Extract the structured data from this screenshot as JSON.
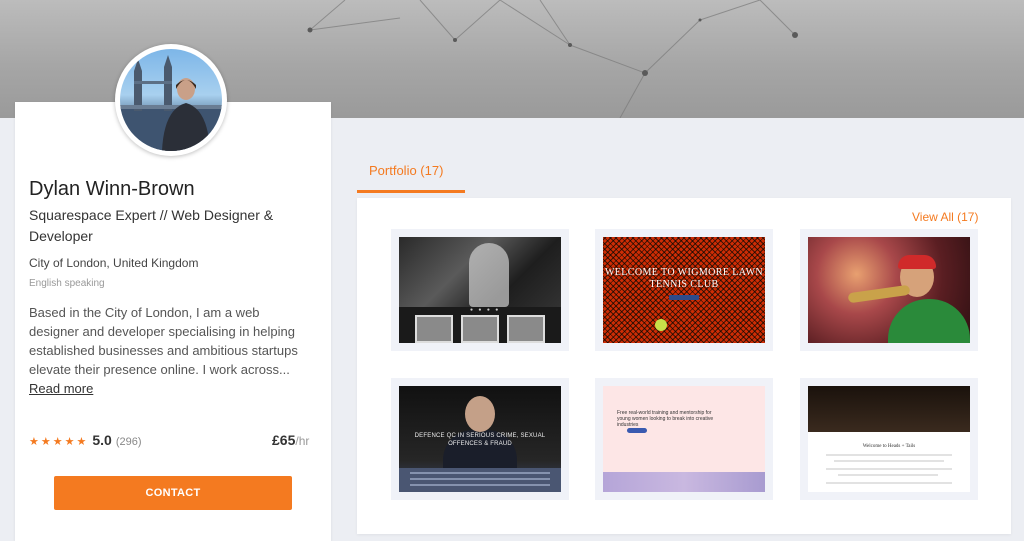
{
  "profile": {
    "name": "Dylan Winn-Brown",
    "title": "Squarespace Expert // Web Designer & Developer",
    "location": "City of London, United Kingdom",
    "language": "English speaking",
    "bio": "Based in the City of London, I am a web designer and developer specialising in helping established businesses and ambitious startups elevate their presence online. I work across...",
    "read_more_label": "Read more",
    "rating": {
      "stars": 5,
      "value": "5.0",
      "count": "(296)"
    },
    "rate": {
      "price": "£65",
      "unit": "/hr"
    },
    "contact_label": "CONTACT"
  },
  "portfolio": {
    "tab_label": "Portfolio (17)",
    "view_all_label": "View All (17)",
    "items": [
      {
        "type": "bw-photo"
      },
      {
        "type": "tennis",
        "headline": "WELCOME TO WIGMORE LAWN TENNIS CLUB"
      },
      {
        "type": "trumpet"
      },
      {
        "type": "barrister",
        "caption": "DEFENCE QC IN SERIOUS CRIME, SEXUAL OFFENCES & FRAUD"
      },
      {
        "type": "pink",
        "text": "Free real-world training and mentorship for young women looking to break into creative industries"
      },
      {
        "type": "restaurant",
        "heading": "Welcome to Heads + Tails"
      }
    ]
  },
  "colors": {
    "accent": "#f47a20",
    "background": "#eceef3"
  },
  "icons": {
    "star": "star-icon"
  }
}
